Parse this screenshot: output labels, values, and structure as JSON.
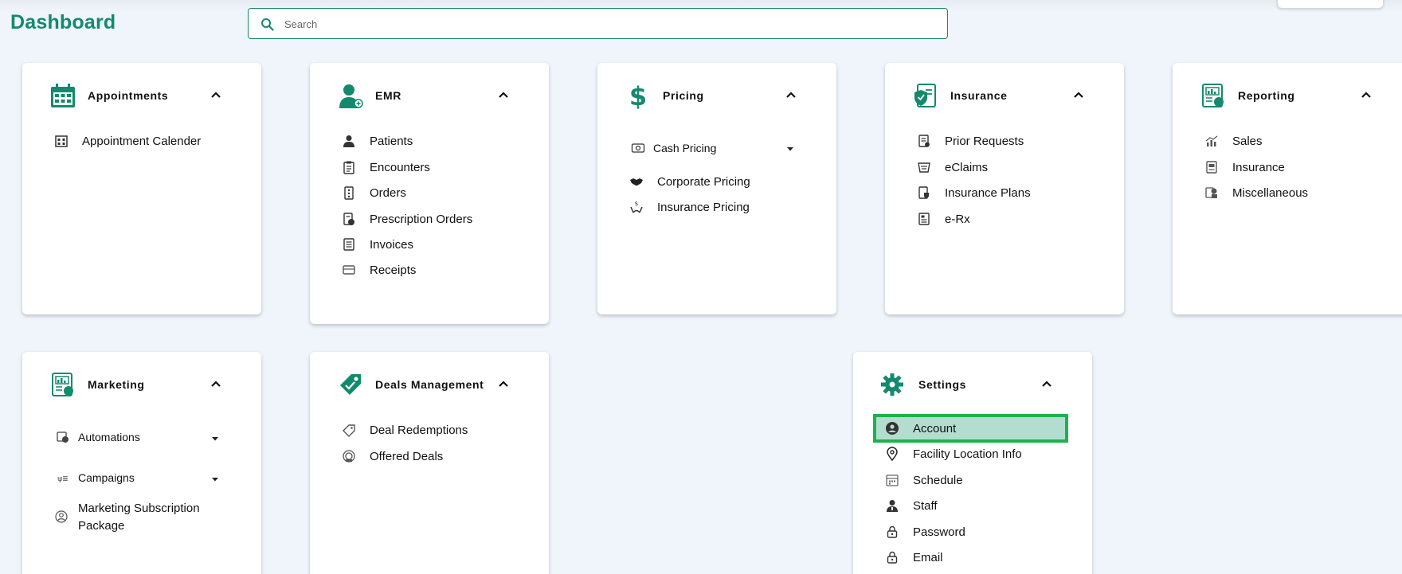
{
  "header": {
    "title": "Dashboard",
    "search_placeholder": "Search"
  },
  "cards": {
    "appointments": {
      "title": "Appointments",
      "items": [
        "Appointment Calender"
      ]
    },
    "emr": {
      "title": "EMR",
      "items": [
        "Patients",
        "Encounters",
        "Orders",
        "Prescription Orders",
        "Invoices",
        "Receipts"
      ]
    },
    "pricing": {
      "title": "Pricing",
      "dropdown": "Cash Pricing",
      "items": [
        "Corporate Pricing",
        "Insurance Pricing"
      ]
    },
    "insurance": {
      "title": "Insurance",
      "items": [
        "Prior Requests",
        "eClaims",
        "Insurance Plans",
        "e-Rx"
      ]
    },
    "reporting": {
      "title": "Reporting",
      "items": [
        "Sales",
        "Insurance",
        "Miscellaneous"
      ]
    },
    "marketing": {
      "title": "Marketing",
      "dropdowns": [
        "Automations",
        "Campaigns"
      ],
      "items": [
        "Marketing Subscription",
        "Package"
      ]
    },
    "deals": {
      "title": "Deals Management",
      "items": [
        "Deal Redemptions",
        "Offered Deals"
      ]
    },
    "settings": {
      "title": "Settings",
      "items": [
        "Account",
        "Facility Location Info",
        "Schedule",
        "Staff",
        "Password",
        "Email"
      ]
    }
  },
  "colors": {
    "brand": "#138a6e",
    "highlight_border": "#1bb34c",
    "highlight_fill": "#b4ddd1",
    "background": "#eff5fb"
  }
}
